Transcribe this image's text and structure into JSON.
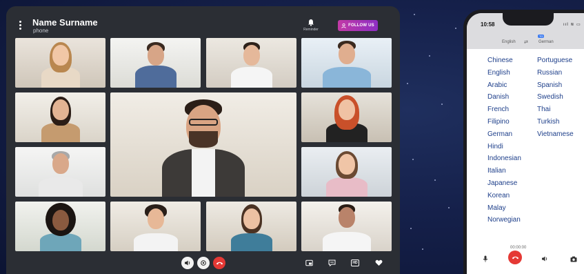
{
  "caller": {
    "name": "Name Surname",
    "subtitle": "phone"
  },
  "topbar": {
    "reminder_label": "Reminder",
    "follow_label": "FOLLOW US",
    "accent": "#b43ab5"
  },
  "participants_count": 13,
  "controls": {
    "end_call_color": "#e53935",
    "icons": [
      "speaker-icon",
      "switch-camera-icon",
      "end-call-icon",
      "picture-in-picture-icon",
      "chat-icon",
      "hd-icon",
      "heart-icon"
    ],
    "hd_label": "HD"
  },
  "phone": {
    "time": "10:58",
    "status_icons": "ııl ≋ ▭",
    "lang_from": "English",
    "lang_to": "German",
    "swap_glyph": "⇄",
    "lang_badge": "TO",
    "languages_left": [
      "Chinese",
      "English",
      "Arabic",
      "Danish",
      "French",
      "Filipino",
      "German",
      "Hindi",
      "Indonesian",
      "Italian",
      "Japanese",
      "Korean",
      "Malay",
      "Norwegian"
    ],
    "languages_right": [
      "Portuguese",
      "Russian",
      "Spanish",
      "Swedish",
      "Thai",
      "Turkish",
      "Vietnamese"
    ],
    "call_timer": "00:00:00"
  }
}
